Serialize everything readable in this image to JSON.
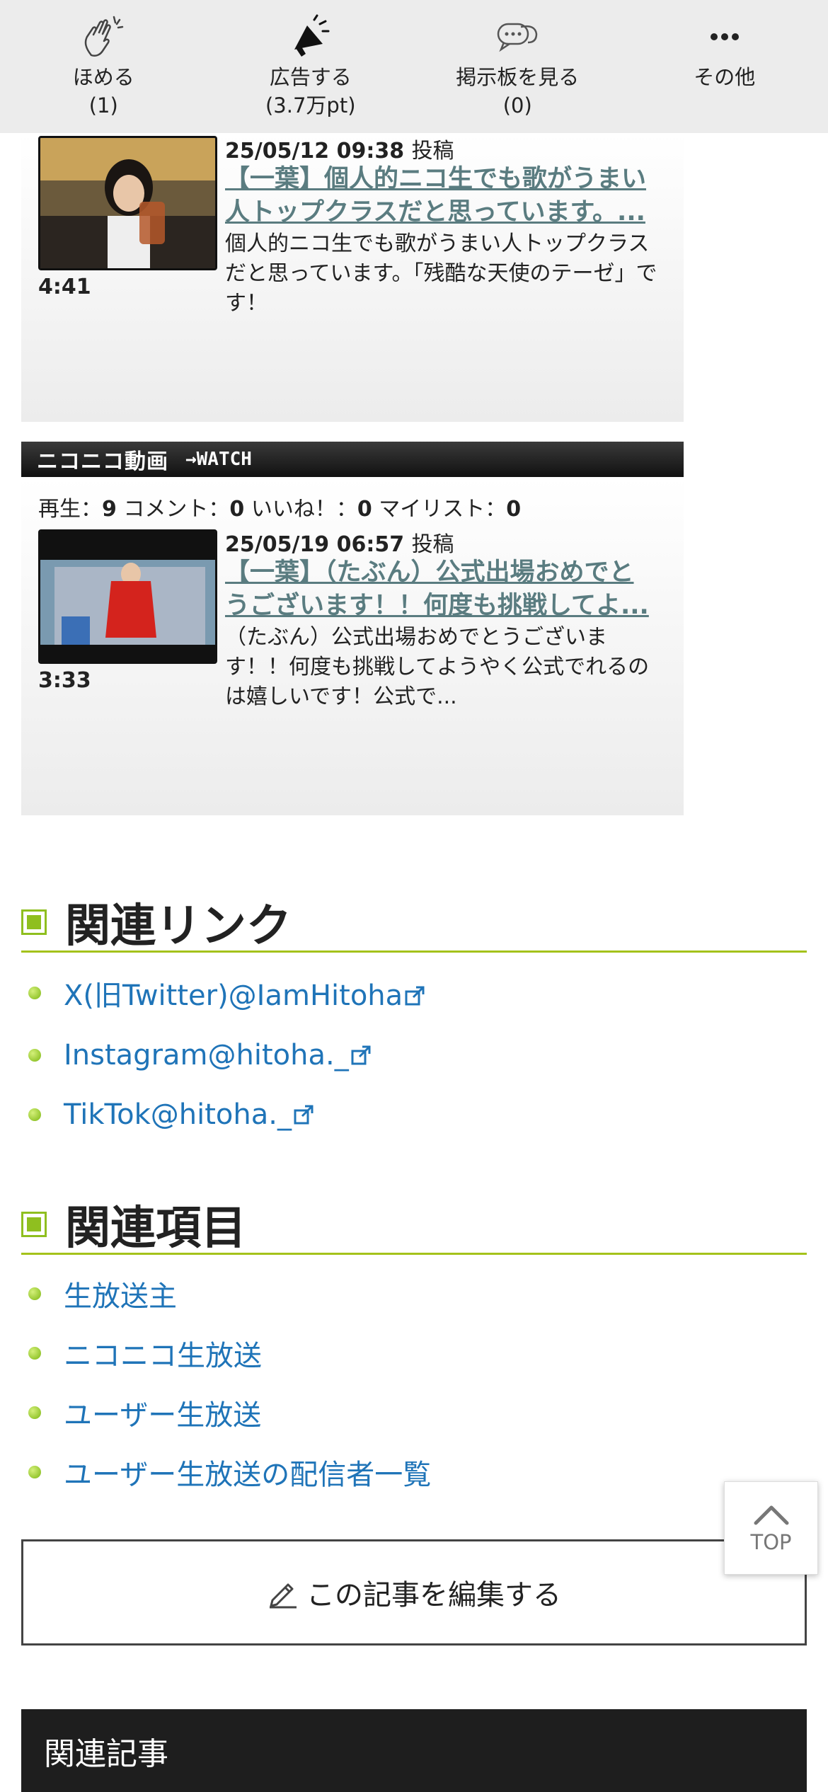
{
  "action_bar": {
    "items": [
      {
        "icon": "clap-hands-icon",
        "label": "ほめる",
        "count": "(1)"
      },
      {
        "icon": "megaphone-icon",
        "label": "広告する",
        "count": "(3.7万pt)"
      },
      {
        "icon": "speech-bubbles-icon",
        "label": "掲示板を見る",
        "count": "(0)"
      },
      {
        "icon": "more-dots-icon",
        "label": "その他",
        "count": ""
      }
    ]
  },
  "videos": [
    {
      "duration": "4:41",
      "date": "25/05/12 09:38",
      "posted": "投稿",
      "title_line1": "【一葉】個人的ニコ生でも歌がうまい",
      "title_line2": "人トップクラスだと思っています。...",
      "desc": "個人的ニコ生でも歌がうまい人トップクラスだと思っています。「残酷な天使のテーゼ」です！"
    },
    {
      "stats": {
        "play_label": "再生：",
        "play": "9",
        "comment_label": "コメント：",
        "comment": "0",
        "like_label": "いいね！：",
        "like": "0",
        "mylist_label": "マイリスト：",
        "mylist": "0"
      },
      "duration": "3:33",
      "date": "25/05/19 06:57",
      "posted": "投稿",
      "title_line1": "【一葉】（たぶん）公式出場おめでと",
      "title_line2": "うございます！！何度も挑戦してよ...",
      "desc": "（たぶん）公式出場おめでとうございます！！何度も挑戦してようやく公式でれるのは嬉しいです！公式で..."
    }
  ],
  "niconico_bar": {
    "logo": "ニコニコ動画",
    "watch": "→WATCH"
  },
  "related_links": {
    "heading": "関連リンク",
    "items": [
      "X(旧Twitter)@IamHitoha",
      "Instagram@hitoha._",
      "TikTok@hitoha._"
    ]
  },
  "related_items": {
    "heading": "関連項目",
    "items": [
      "生放送主",
      "ニコニコ生放送",
      "ユーザー生放送",
      "ユーザー生放送の配信者一覧"
    ]
  },
  "edit_button": {
    "label": "この記事を編集する"
  },
  "to_top": {
    "label": "TOP"
  },
  "related_articles": {
    "heading": "関連記事"
  },
  "colors": {
    "link": "#1f74b8",
    "accent_green": "#a4c21b",
    "video_title": "#5a7c80"
  }
}
